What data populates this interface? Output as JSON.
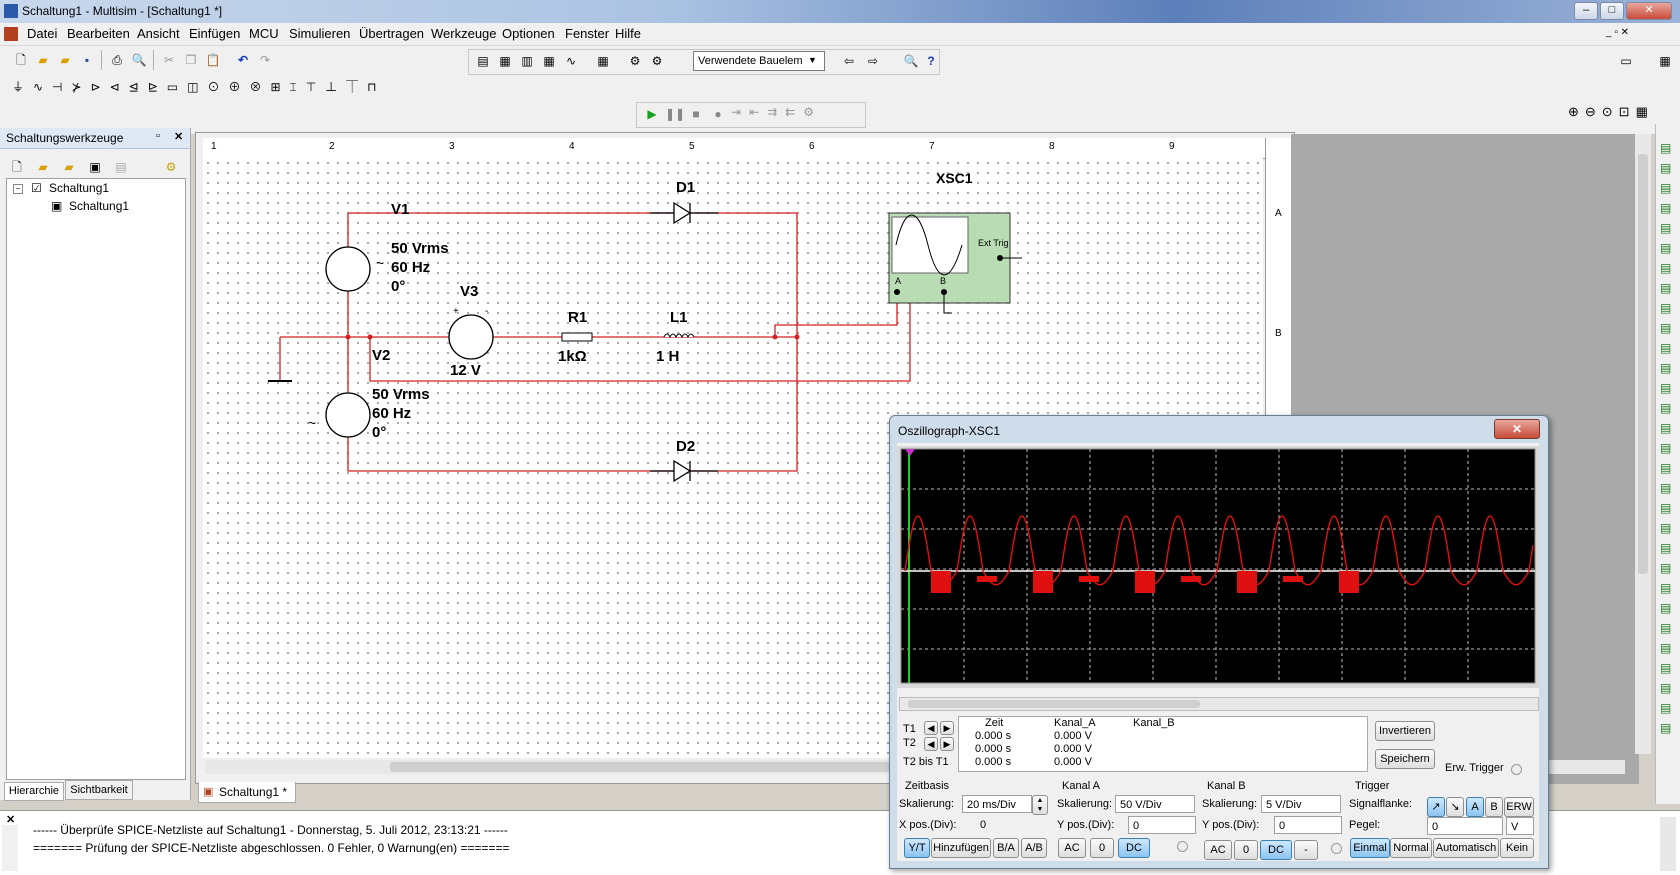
{
  "window": {
    "title": "Schaltung1 - Multisim - [Schaltung1 *]"
  },
  "menu": [
    "Datei",
    "Bearbeiten",
    "Ansicht",
    "Einfügen",
    "MCU",
    "Simulieren",
    "Übertragen",
    "Werkzeuge",
    "Optionen",
    "Fenster",
    "Hilfe"
  ],
  "toolbar": {
    "in_use_list": "Verwendete Bauelem"
  },
  "left_panel": {
    "title": "Schaltungswerkzeuge",
    "tree_root": "Schaltung1",
    "tree_child": "Schaltung1",
    "tabs": [
      "Hierarchie",
      "Sichtbarkeit"
    ]
  },
  "ruler": {
    "top": [
      "1",
      "2",
      "3",
      "4",
      "5",
      "6",
      "7",
      "8",
      "9"
    ],
    "side": [
      "A",
      "B"
    ]
  },
  "schematic": {
    "v1": {
      "name": "V1",
      "amp": "50 Vrms",
      "freq": "60 Hz",
      "phase": "0°"
    },
    "v2": {
      "name": "V2",
      "amp": "50 Vrms",
      "freq": "60 Hz",
      "phase": "0°"
    },
    "v3": {
      "name": "V3",
      "value": "12 V"
    },
    "r1": {
      "name": "R1",
      "value": "1kΩ"
    },
    "l1": {
      "name": "L1",
      "value": "1 H"
    },
    "d1": {
      "name": "D1"
    },
    "d2": {
      "name": "D2"
    },
    "xsc1": {
      "name": "XSC1",
      "ext_trig": "Ext Trig",
      "a": "A",
      "b": "B"
    }
  },
  "doc_tab": "Schaltung1 *",
  "oscilloscope": {
    "title": "Oszillograph-XSC1",
    "t1": "T1",
    "t2": "T2",
    "t2t1": "T2 bis T1",
    "col_time": "Zeit",
    "col_a": "Kanal_A",
    "col_b": "Kanal_B",
    "rows": [
      {
        "time": "0.000 s",
        "a": "0.000 V"
      },
      {
        "time": "0.000 s",
        "a": "0.000 V"
      },
      {
        "time": "0.000 s",
        "a": "0.000 V"
      }
    ],
    "invert": "Invertieren",
    "save": "Speichern",
    "ext_trigger": "Erw. Trigger",
    "timebase": {
      "title": "Zeitbasis",
      "scale_label": "Skalierung:",
      "scale": "20 ms/Div",
      "xpos_label": "X pos.(Div):",
      "xpos": "0",
      "yt": "Y/T",
      "add": "Hinzufügen",
      "ba": "B/A",
      "ab": "A/B"
    },
    "chA": {
      "title": "Kanal A",
      "scale_label": "Skalierung:",
      "scale": "50  V/Div",
      "ypos_label": "Y pos.(Div):",
      "ypos": "0",
      "ac": "AC",
      "zero": "0",
      "dc": "DC"
    },
    "chB": {
      "title": "Kanal B",
      "scale_label": "Skalierung:",
      "scale": "5  V/Div",
      "ypos_label": "Y pos.(Div):",
      "ypos": "0",
      "ac": "AC",
      "zero": "0",
      "dc": "DC",
      "minus": "-"
    },
    "trigger": {
      "title": "Trigger",
      "edge_label": "Signalflanke:",
      "a": "A",
      "b": "B",
      "ext": "ERW",
      "level_label": "Pegel:",
      "level": "0",
      "unit": "V",
      "once": "Einmal",
      "normal": "Normal",
      "auto": "Automatisch",
      "none": "Kein"
    }
  },
  "output": {
    "line1": "------ Überprüfe SPICE-Netzliste auf Schaltung1 - Donnerstag, 5. Juli 2012, 23:13:21 ------",
    "line2": "======= Prüfung der SPICE-Netzliste abgeschlossen. 0 Fehler, 0 Warnung(en) ======="
  },
  "colors": {
    "wire": "#d42020",
    "scope_bg": "#000000",
    "trace": "#e01010",
    "baseline": "#ffffff"
  }
}
